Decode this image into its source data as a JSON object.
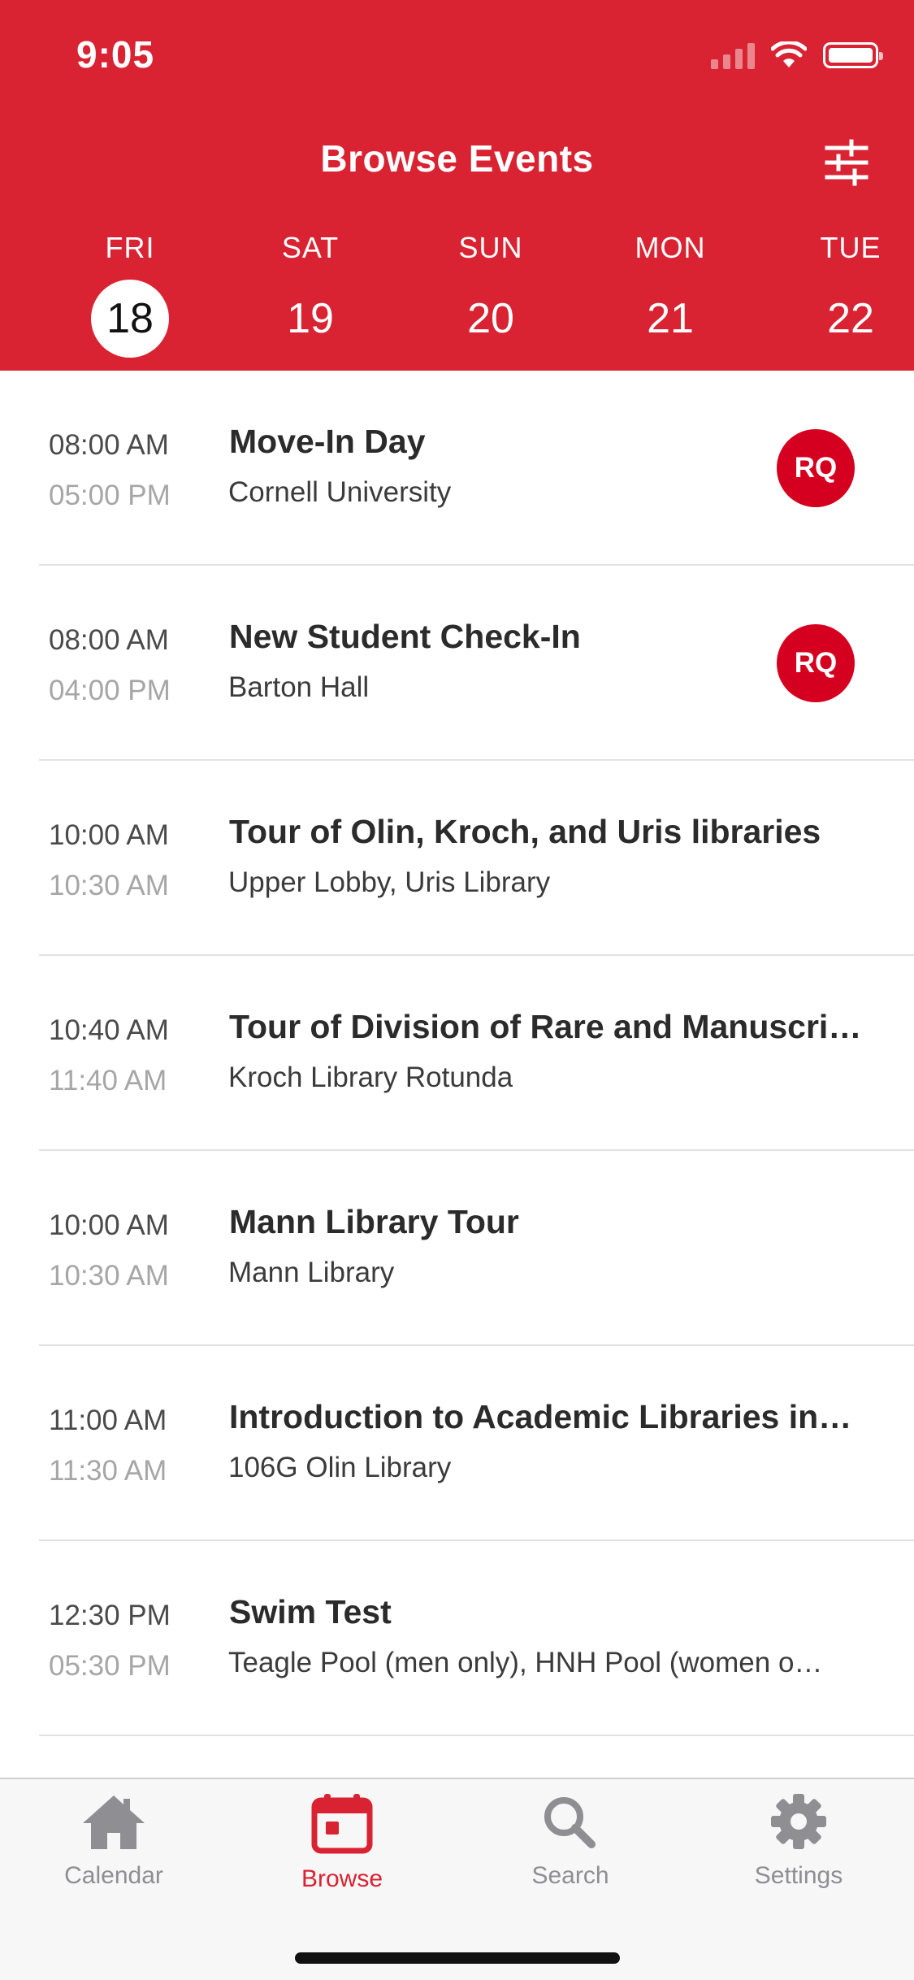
{
  "status_bar": {
    "time": "9:05"
  },
  "header": {
    "title": "Browse Events"
  },
  "days": [
    {
      "dow": "FRI",
      "num": "18",
      "selected": true
    },
    {
      "dow": "SAT",
      "num": "19"
    },
    {
      "dow": "SUN",
      "num": "20"
    },
    {
      "dow": "MON",
      "num": "21"
    },
    {
      "dow": "TUE",
      "num": "22"
    }
  ],
  "events": [
    {
      "start": "08:00 AM",
      "end": "05:00 PM",
      "title": "Move-In Day",
      "location": "Cornell University",
      "badge": "RQ"
    },
    {
      "start": "08:00 AM",
      "end": "04:00 PM",
      "title": "New Student Check-In",
      "location": "Barton Hall",
      "badge": "RQ"
    },
    {
      "start": "10:00 AM",
      "end": "10:30 AM",
      "title": "Tour of Olin, Kroch, and Uris libraries",
      "location": "Upper Lobby, Uris Library"
    },
    {
      "start": "10:40 AM",
      "end": "11:40 AM",
      "title": "Tour of Division of Rare and Manuscri…",
      "location": "Kroch Library Rotunda"
    },
    {
      "start": "10:00 AM",
      "end": "10:30 AM",
      "title": "Mann Library Tour",
      "location": "Mann Library"
    },
    {
      "start": "11:00 AM",
      "end": "11:30 AM",
      "title": "Introduction to Academic Libraries in…",
      "location": "106G Olin Library"
    },
    {
      "start": "12:30 PM",
      "end": "05:30 PM",
      "title": "Swim Test",
      "location": "Teagle Pool (men only), HNH Pool (women o…"
    }
  ],
  "tabbar": {
    "tabs": [
      {
        "label": "Calendar",
        "icon": "home-icon"
      },
      {
        "label": "Browse",
        "icon": "calendar-icon",
        "active": true
      },
      {
        "label": "Search",
        "icon": "search-icon"
      },
      {
        "label": "Settings",
        "icon": "gear-icon"
      }
    ]
  },
  "colors": {
    "accent": "#d92332",
    "badge": "#d5001f",
    "inactive_tab": "#8e8e93"
  }
}
